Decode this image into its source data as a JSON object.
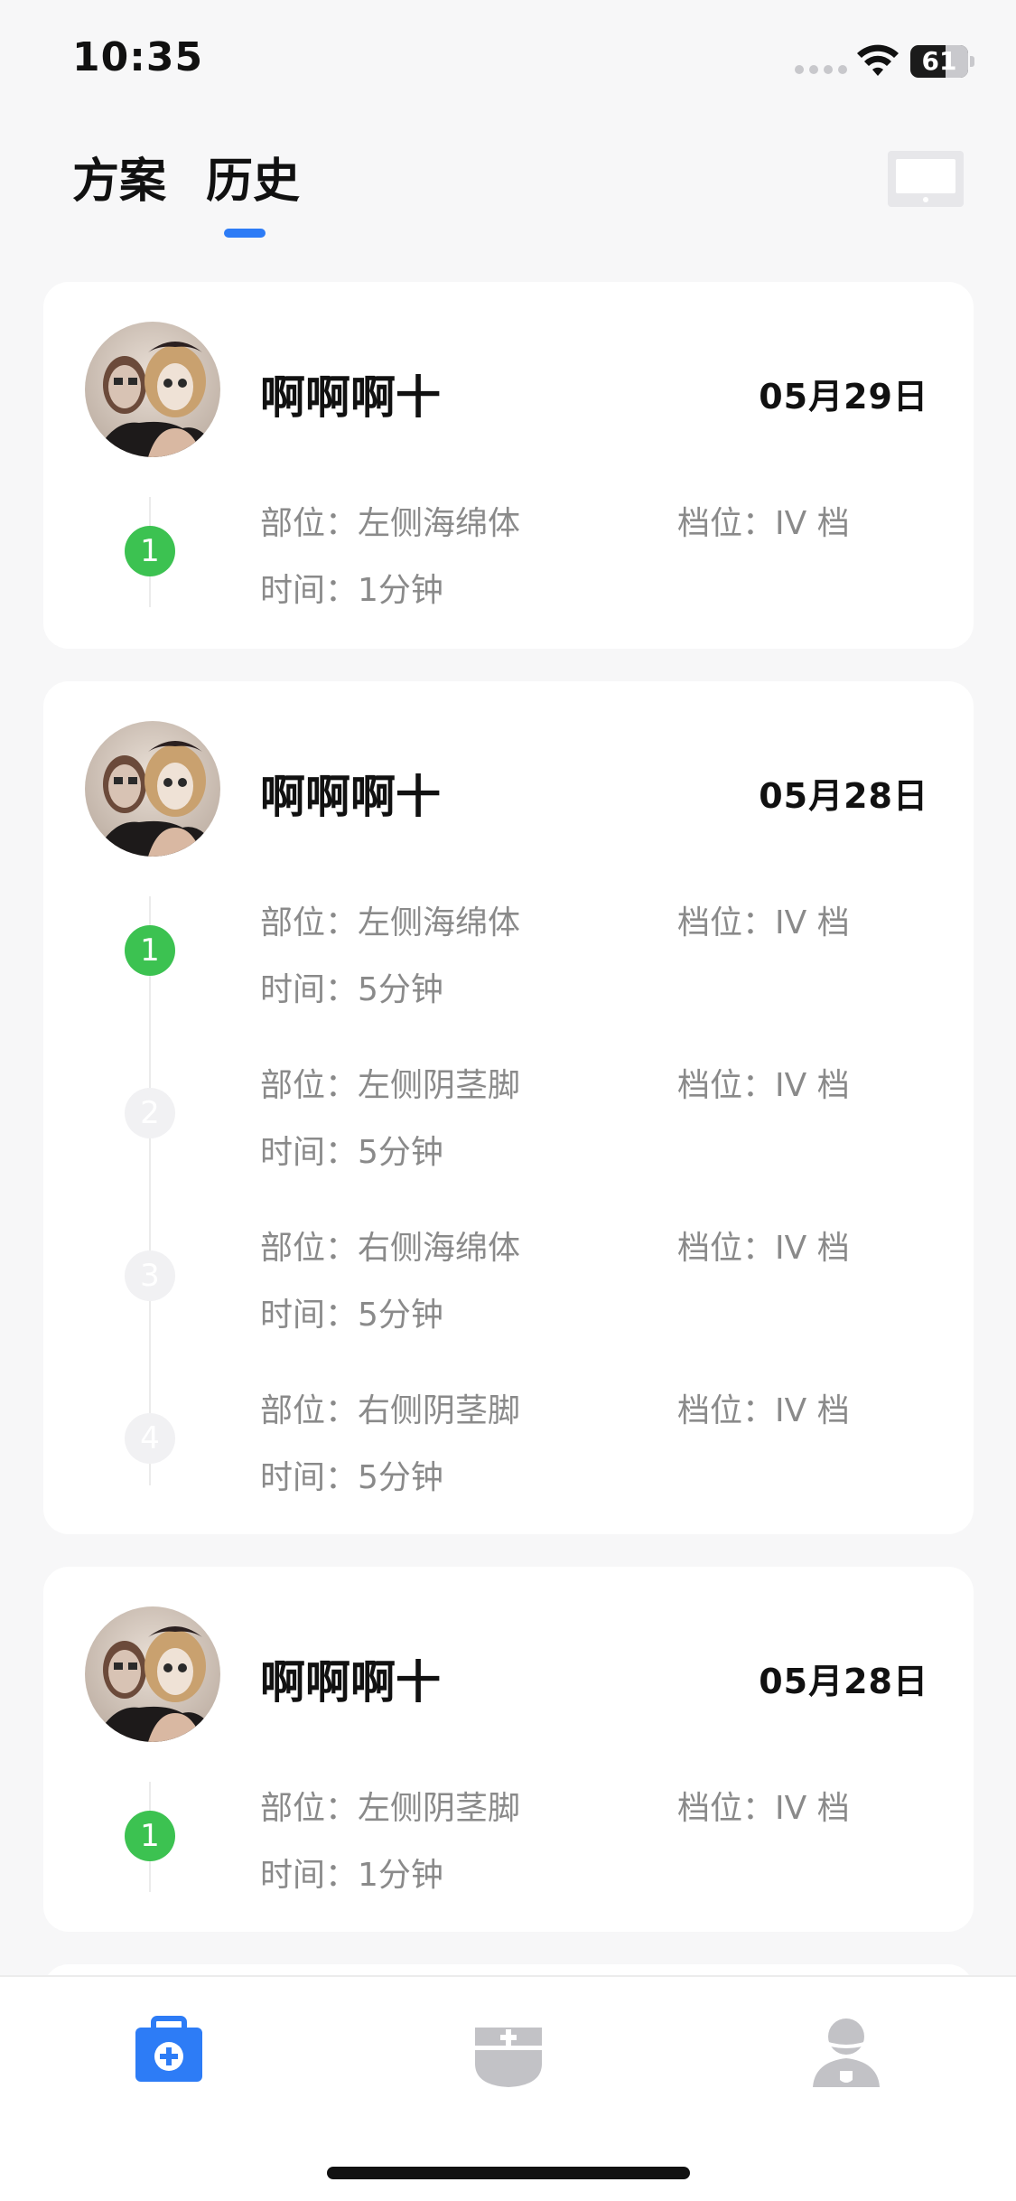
{
  "status_bar": {
    "time": "10:35",
    "battery_level": "61",
    "wifi_icon": "wifi-icon",
    "signal_icon": "signal-dots-icon"
  },
  "header": {
    "tabs": [
      {
        "label": "方案",
        "active": false
      },
      {
        "label": "历史",
        "active": true
      }
    ],
    "accent_color": "#2d7cf6",
    "device_icon": "tablet-icon"
  },
  "labels": {
    "location": "部位：",
    "level": "档位：",
    "time": "时间："
  },
  "history": [
    {
      "name": "啊啊啊十",
      "date": "05月29日",
      "steps": [
        {
          "index": "1",
          "active": true,
          "location": "左侧海绵体",
          "level": "IV 档",
          "time": "1分钟"
        }
      ]
    },
    {
      "name": "啊啊啊十",
      "date": "05月28日",
      "steps": [
        {
          "index": "1",
          "active": true,
          "location": "左侧海绵体",
          "level": "IV 档",
          "time": "5分钟"
        },
        {
          "index": "2",
          "active": false,
          "location": "左侧阴茎脚",
          "level": "IV 档",
          "time": "5分钟"
        },
        {
          "index": "3",
          "active": false,
          "location": "右侧海绵体",
          "level": "IV 档",
          "time": "5分钟"
        },
        {
          "index": "4",
          "active": false,
          "location": "右侧阴茎脚",
          "level": "IV 档",
          "time": "5分钟"
        }
      ]
    },
    {
      "name": "啊啊啊十",
      "date": "05月28日",
      "steps": [
        {
          "index": "1",
          "active": true,
          "location": "左侧阴茎脚",
          "level": "IV 档",
          "time": "1分钟"
        }
      ]
    }
  ],
  "bottom_nav": {
    "items": [
      {
        "icon": "medical-kit-icon",
        "active": true,
        "color": "#2d7cf6"
      },
      {
        "icon": "plan-add-icon",
        "active": false,
        "color": "#c2c2c6"
      },
      {
        "icon": "profile-icon",
        "active": false,
        "color": "#c2c2c6"
      }
    ]
  }
}
